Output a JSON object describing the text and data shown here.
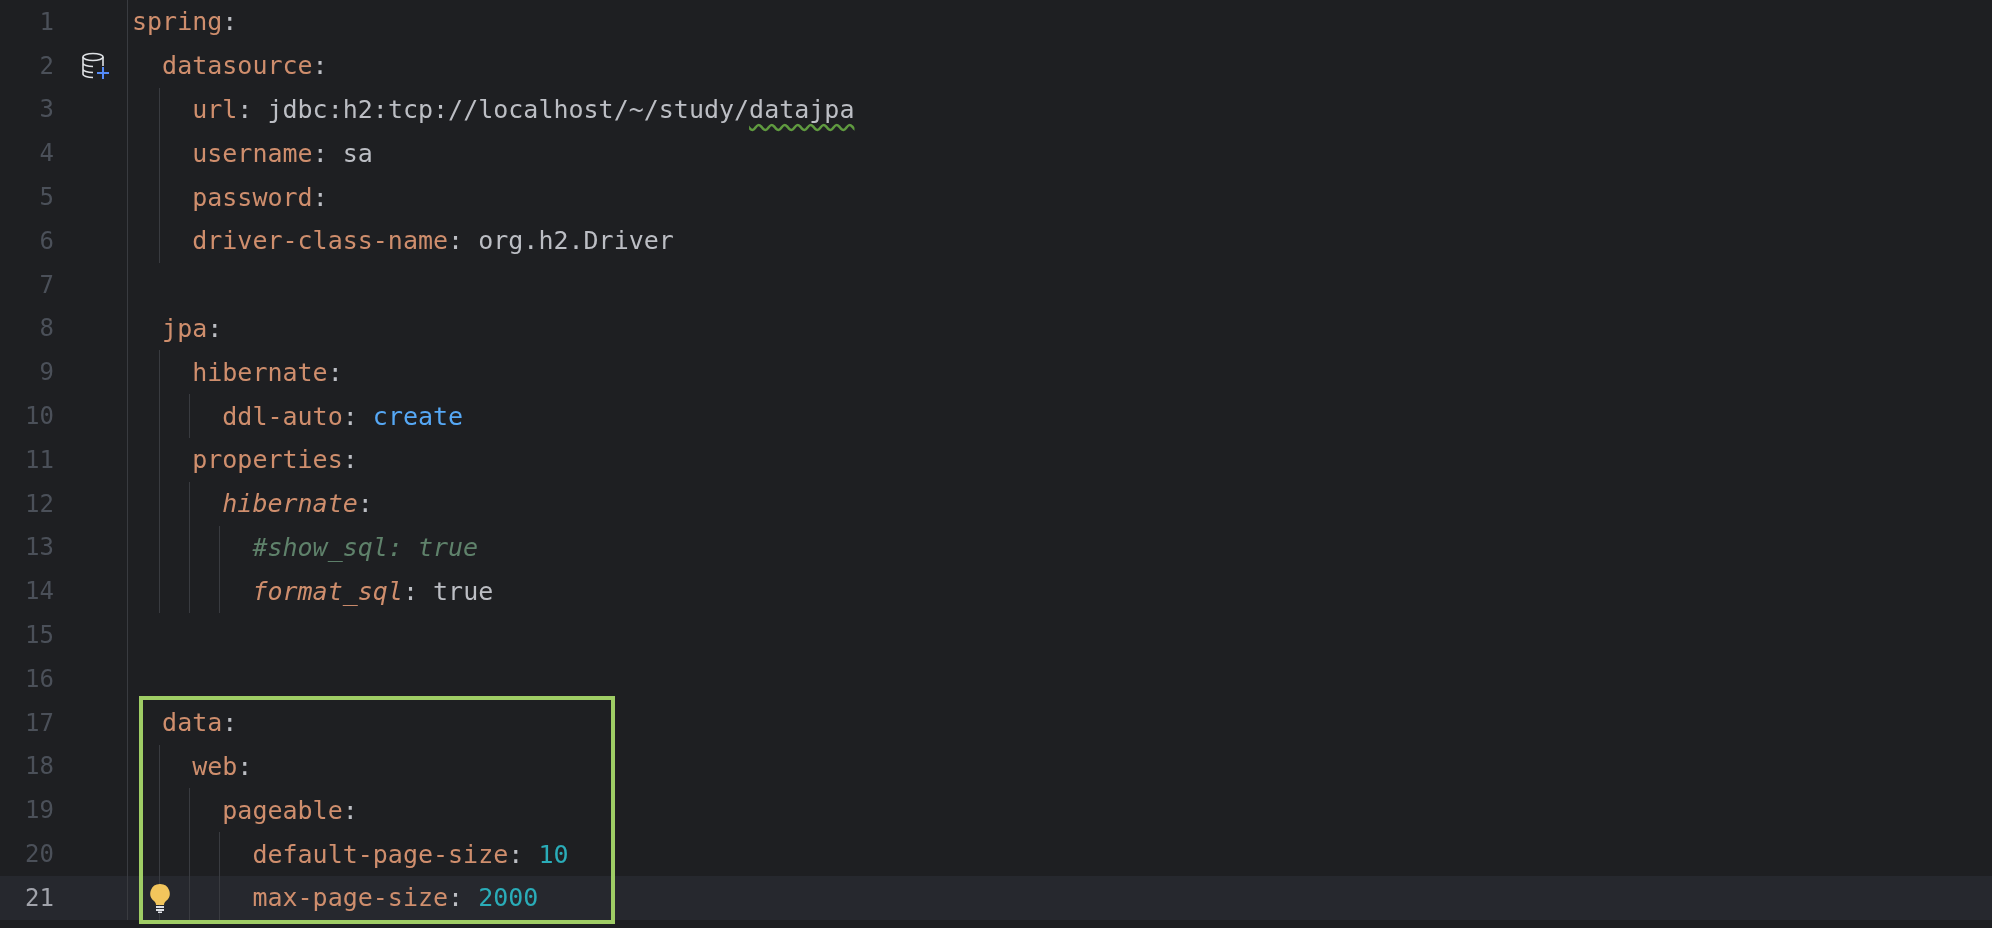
{
  "lines": [
    {
      "number": "1",
      "current": false,
      "tokens": [
        {
          "kind": "key",
          "text": "spring"
        },
        {
          "kind": "punct",
          "text": ":"
        }
      ],
      "children": [
        {
          "number": "2",
          "current": false,
          "gutter_marker": {
            "kind": "database"
          },
          "tokens": [
            {
              "kind": "key",
              "text": "datasource"
            },
            {
              "kind": "punct",
              "text": ":"
            }
          ],
          "children": [
            {
              "number": "3",
              "current": false,
              "tokens": [
                {
                  "kind": "key",
                  "text": "url"
                },
                {
                  "kind": "punct",
                  "text": ":"
                },
                {
                  "kind": "value",
                  "text": "jdbc:h2:tcp://localhost/~/study/"
                },
                {
                  "kind": "misspelled",
                  "text": "datajpa"
                }
              ]
            },
            {
              "number": "4",
              "current": false,
              "tokens": [
                {
                  "kind": "key",
                  "text": "username"
                },
                {
                  "kind": "punct",
                  "text": ":"
                },
                {
                  "kind": "value",
                  "text": "sa"
                }
              ]
            },
            {
              "number": "5",
              "current": false,
              "tokens": [
                {
                  "kind": "key",
                  "text": "password"
                },
                {
                  "kind": "punct",
                  "text": ":"
                }
              ]
            },
            {
              "number": "6",
              "current": false,
              "tokens": [
                {
                  "kind": "key",
                  "text": "driver-class-name"
                },
                {
                  "kind": "punct",
                  "text": ":"
                },
                {
                  "kind": "value",
                  "text": "org.h2.Driver"
                }
              ]
            }
          ]
        },
        {
          "number": "7",
          "current": false
        },
        {
          "number": "8",
          "current": false,
          "tokens": [
            {
              "kind": "key",
              "text": "jpa"
            },
            {
              "kind": "punct",
              "text": ":"
            }
          ],
          "children": [
            {
              "number": "9",
              "current": false,
              "tokens": [
                {
                  "kind": "key",
                  "text": "hibernate"
                },
                {
                  "kind": "punct",
                  "text": ":"
                }
              ],
              "children": [
                {
                  "number": "10",
                  "current": false,
                  "tokens": [
                    {
                      "kind": "key",
                      "text": "ddl-auto"
                    },
                    {
                      "kind": "punct",
                      "text": ":"
                    },
                    {
                      "kind": "keyword",
                      "text": "create"
                    }
                  ]
                }
              ]
            },
            {
              "number": "11",
              "current": false,
              "tokens": [
                {
                  "kind": "key",
                  "text": "properties"
                },
                {
                  "kind": "punct",
                  "text": ":"
                }
              ],
              "children": [
                {
                  "number": "12",
                  "current": false,
                  "tokens": [
                    {
                      "kind": "italic-key",
                      "text": "hibernate"
                    },
                    {
                      "kind": "punct",
                      "text": ":"
                    }
                  ],
                  "children": [
                    {
                      "number": "13",
                      "current": false,
                      "tokens": [
                        {
                          "kind": "comment",
                          "text": "#show_sql: true"
                        }
                      ]
                    },
                    {
                      "number": "14",
                      "current": false,
                      "tokens": [
                        {
                          "kind": "italic-key",
                          "text": "format_sql"
                        },
                        {
                          "kind": "punct",
                          "text": ":"
                        },
                        {
                          "kind": "value",
                          "text": "true"
                        }
                      ]
                    }
                  ]
                }
              ]
            }
          ]
        },
        {
          "number": "15",
          "current": false
        },
        {
          "number": "16",
          "current": false
        },
        {
          "number": "17",
          "current": false,
          "highlighted": true,
          "tokens": [
            {
              "kind": "key",
              "text": "data"
            },
            {
              "kind": "punct",
              "text": ":"
            }
          ],
          "children": [
            {
              "number": "18",
              "current": false,
              "tokens": [
                {
                  "kind": "key",
                  "text": "web"
                },
                {
                  "kind": "punct",
                  "text": ":"
                }
              ],
              "children": [
                {
                  "number": "19",
                  "current": false,
                  "tokens": [
                    {
                      "kind": "key",
                      "text": "pageable"
                    },
                    {
                      "kind": "punct",
                      "text": ":"
                    }
                  ],
                  "children": [
                    {
                      "number": "20",
                      "current": false,
                      "tokens": [
                        {
                          "kind": "key",
                          "text": "default-page-size"
                        },
                        {
                          "kind": "punct",
                          "text": ":"
                        },
                        {
                          "kind": "number",
                          "text": "10"
                        }
                      ]
                    },
                    {
                      "number": "21",
                      "current": true,
                      "hint": {
                        "kind": "bulb"
                      },
                      "tokens": [
                        {
                          "kind": "key",
                          "text": "max-page-size"
                        },
                        {
                          "kind": "punct",
                          "text": ":"
                        },
                        {
                          "kind": "number",
                          "text": "2000"
                        }
                      ]
                    }
                  ]
                }
              ]
            }
          ]
        }
      ]
    }
  ]
}
